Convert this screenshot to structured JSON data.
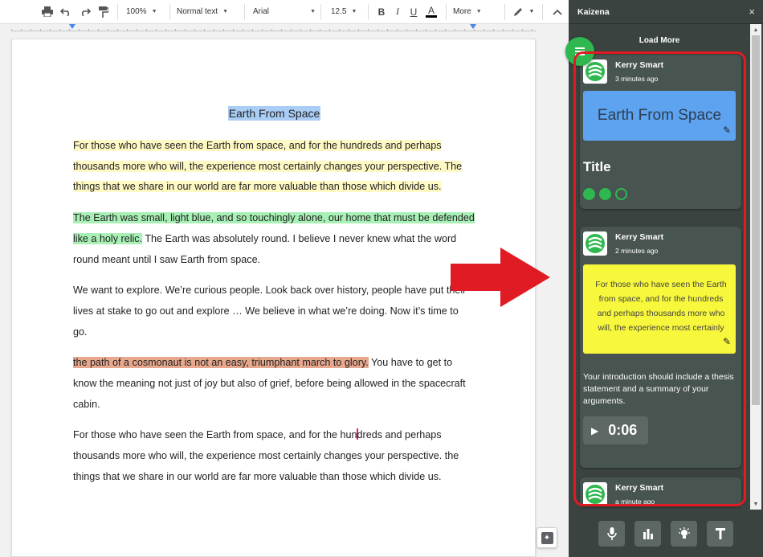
{
  "toolbar": {
    "zoom": "100%",
    "style": "Normal text",
    "font": "Arial",
    "font_size": "12.5",
    "bold": "B",
    "italic": "I",
    "underline": "U",
    "text_color": "A",
    "more": "More",
    "icons": [
      "print-icon",
      "undo-icon",
      "redo-icon",
      "paint-format-icon",
      "pencil-icon",
      "collapse-icon"
    ]
  },
  "document": {
    "title": "Earth From Space",
    "paragraphs": [
      {
        "segments": [
          {
            "text": "For those who have seen the Earth from space, and for the hundreds and perhaps thousands more who will, the experience most certainly changes your perspective. The things that we share in our world are far more valuable than those which divide us.",
            "highlight": "yellow"
          }
        ]
      },
      {
        "segments": [
          {
            "text": "The Earth was small, light blue, and so touchingly alone, our home that must be defended like a holy relic.",
            "highlight": "green"
          },
          {
            "text": " The Earth was absolutely round. I believe I never knew what the word round meant until I saw Earth from space.",
            "highlight": "none"
          }
        ]
      },
      {
        "segments": [
          {
            "text": "We want to explore. We’re curious people. Look back over history, people have put their lives at stake to go out and explore … We believe in what we’re doing. Now it’s time to go.",
            "highlight": "none"
          }
        ]
      },
      {
        "segments": [
          {
            "text": "the path of a cosmonaut is not an easy, triumphant march to glory.",
            "highlight": "salmon"
          },
          {
            "text": " You have to get to know the meaning not just of joy but also of grief, before being allowed in the spacecraft cabin.",
            "highlight": "none"
          }
        ]
      },
      {
        "segments": [
          {
            "text": "For those who have seen the Earth from space, and for the hun",
            "highlight": "none"
          },
          {
            "text": "",
            "highlight": "cursor"
          },
          {
            "text": "dreds and perhaps thousands more who will, the experience most certainly changes your perspective. the things that we share in our world are far more valuable than those which divide us.",
            "highlight": "none"
          }
        ]
      }
    ]
  },
  "panel": {
    "title": "Kaizena",
    "close": "×",
    "load_more": "Load More",
    "cards": [
      {
        "author": "Kerry Smart",
        "time": "3 minutes ago",
        "quote": "Earth From Space",
        "label": "Title",
        "rating": [
          true,
          true,
          false
        ]
      },
      {
        "author": "Kerry Smart",
        "time": "2 minutes ago",
        "quote": "For those who have seen the Earth from space, and for the hundreds and perhaps thousands more who will, the experience most certainly",
        "comment": "Your introduction should include a thesis statement and a summary of your arguments.",
        "audio": "0:06"
      },
      {
        "author": "Kerry Smart",
        "time": "a minute ago"
      }
    ],
    "footer_icons": [
      "microphone-icon",
      "chart-icon",
      "lightbulb-icon",
      "text-icon"
    ]
  },
  "colors": {
    "panel_bg": "#3a4340",
    "card_bg": "#485450",
    "accent_green": "#2eb84f",
    "highlight_yellow": "#fff9c4",
    "highlight_green": "#a8f0b5",
    "highlight_salmon": "#e8a88e",
    "title_highlight": "#a9cdf5",
    "annotation_red": "#e01b24"
  }
}
